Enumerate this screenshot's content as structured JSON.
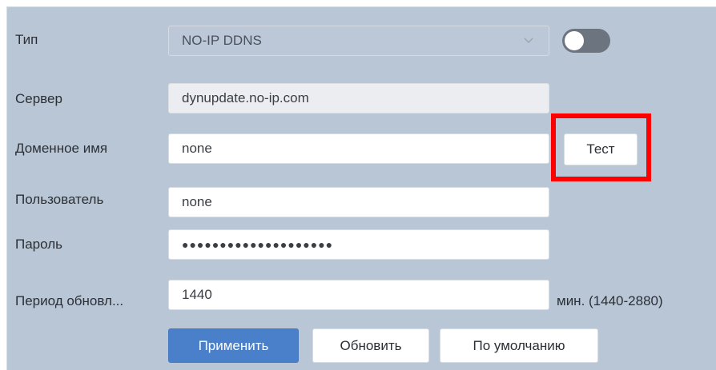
{
  "form": {
    "type": {
      "label": "Тип",
      "value": "NO-IP DDNS",
      "enabled": false
    },
    "server": {
      "label": "Сервер",
      "value": "dynupdate.no-ip.com"
    },
    "domain": {
      "label": "Доменное имя",
      "value": "none",
      "test_label": "Тест"
    },
    "user": {
      "label": "Пользователь",
      "value": "none"
    },
    "password": {
      "label": "Пароль",
      "value": "●●●●●●●●●●●●●●●●●●●●"
    },
    "period": {
      "label": "Период обновл...",
      "value": "1440",
      "unit": "мин. (1440-2880)"
    }
  },
  "buttons": {
    "apply": "Применить",
    "refresh": "Обновить",
    "default": "По умолчанию"
  },
  "colors": {
    "panel": "#b9c6d6",
    "primary": "#4a7fc9",
    "highlight": "#ff0000",
    "toggle_off": "#6c7480"
  },
  "icons": {
    "select_arrow": "chevron-down-icon"
  }
}
